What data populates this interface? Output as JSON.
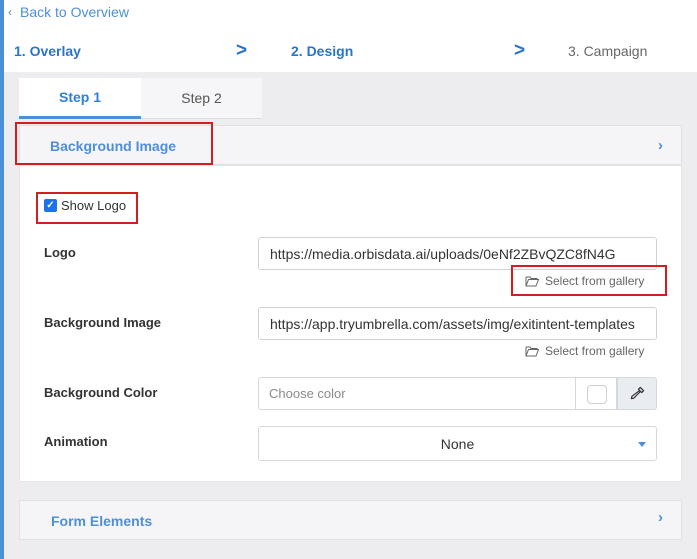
{
  "nav": {
    "back_label": "Back to Overview",
    "steps": [
      "1. Overlay",
      "2. Design",
      "3. Campaign"
    ],
    "separator": ">"
  },
  "tabs": [
    {
      "label": "Step 1",
      "active": true
    },
    {
      "label": "Step 2",
      "active": false
    }
  ],
  "section": {
    "title": "Background Image",
    "show_logo_label": "Show Logo",
    "show_logo_checked": true,
    "logo_label": "Logo",
    "logo_value": "https://media.orbisdata.ai/uploads/0eNf2ZBvQZC8fN4G",
    "gallery_label": "Select from gallery",
    "bg_image_label": "Background Image",
    "bg_image_value": "https://app.tryumbrella.com/assets/img/exitintent-templates",
    "bg_color_label": "Background Color",
    "bg_color_placeholder": "Choose color",
    "animation_label": "Animation",
    "animation_value": "None"
  },
  "section2": {
    "title": "Form Elements"
  },
  "colors": {
    "accent": "#4d8fd8",
    "highlight": "#d21e1e",
    "checkbox": "#1a73e8"
  },
  "icons": {
    "back": "chevron-left-icon",
    "expand": "chevron-right-icon",
    "folder": "folder-open-icon",
    "picker": "eyedropper-icon",
    "dropdown": "caret-down-icon"
  }
}
